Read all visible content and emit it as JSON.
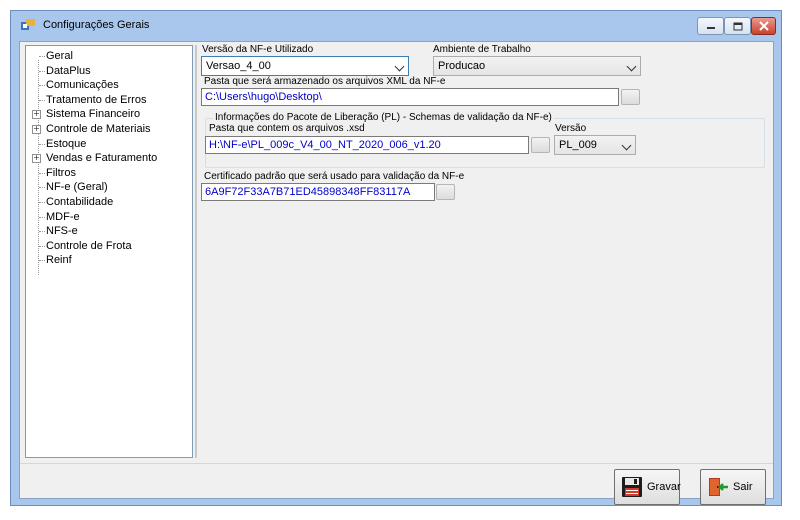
{
  "window": {
    "title": "Configurações Gerais"
  },
  "tree": {
    "items": [
      {
        "label": "Geral",
        "expandable": false
      },
      {
        "label": "DataPlus",
        "expandable": false
      },
      {
        "label": "Comunicações",
        "expandable": false
      },
      {
        "label": "Tratamento de Erros",
        "expandable": false
      },
      {
        "label": "Sistema Financeiro",
        "expandable": true
      },
      {
        "label": "Controle de Materiais",
        "expandable": true
      },
      {
        "label": "Estoque",
        "expandable": false
      },
      {
        "label": "Vendas e Faturamento",
        "expandable": true
      },
      {
        "label": "Filtros",
        "expandable": false
      },
      {
        "label": "NF-e (Geral)",
        "expandable": false
      },
      {
        "label": "Contabilidade",
        "expandable": false
      },
      {
        "label": "MDF-e",
        "expandable": false
      },
      {
        "label": "NFS-e",
        "expandable": false
      },
      {
        "label": "Controle de Frota",
        "expandable": false
      },
      {
        "label": "Reinf",
        "expandable": false
      }
    ]
  },
  "form": {
    "versao_label": "Versão da NF-e Utilizado",
    "versao_value": "Versao_4_00",
    "ambiente_label": "Ambiente de Trabalho",
    "ambiente_value": "Producao",
    "pasta_xml_label": "Pasta que será armazenado os arquivos XML da NF-e",
    "pasta_xml_value": "C:\\Users\\hugo\\Desktop\\",
    "pl_group_title": "Informações do Pacote de Liberação (PL) - Schemas de validação da NF-e)",
    "pasta_xsd_label": "Pasta que contem os arquivos .xsd",
    "pasta_xsd_value": "H:\\NF-e\\PL_009c_V4_00_NT_2020_006_v1.20",
    "pl_versao_label": "Versão",
    "pl_versao_value": "PL_009",
    "cert_label": "Certificado padrão que será usado para validação da NF-e",
    "cert_value": "6A9F72F33A7B71ED45898348FF83117A"
  },
  "buttons": {
    "gravar": "Gravar",
    "sair": "Sair"
  }
}
